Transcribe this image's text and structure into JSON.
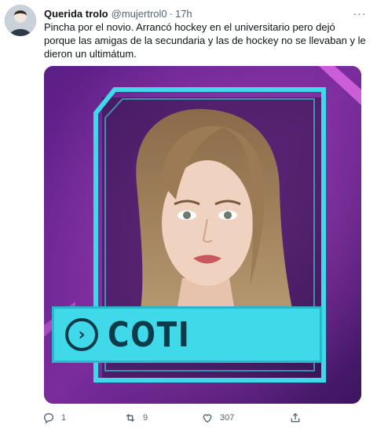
{
  "tweet": {
    "author_name": "Querida trolo",
    "handle": "@mujertrol0",
    "separator": "·",
    "time": "17h",
    "text": "Pincha por el novio. Arrancó hockey en el universitario pero dejó porque las amigas de la secundaria y las de hockey no se llevaban y le dieron un ultimátum.",
    "more_label": "···"
  },
  "media": {
    "banner_name": "COTI",
    "banner_icon": "›",
    "colors": {
      "background": "#6a1f8e",
      "frame": "#3fd9ea",
      "banner": "#3fd9ea",
      "banner_text": "#0d3b4a"
    }
  },
  "actions": {
    "replies": "1",
    "retweets": "9",
    "likes": "307"
  }
}
